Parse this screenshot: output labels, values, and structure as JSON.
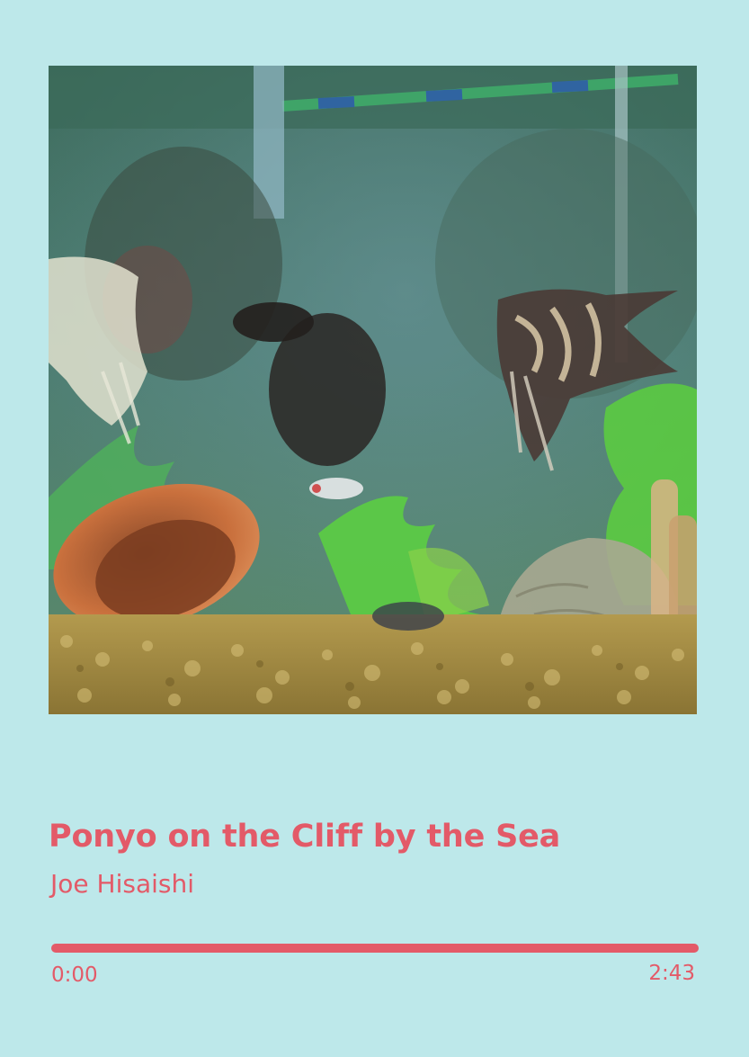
{
  "track": {
    "title": "Ponyo on the Cliff by the Sea",
    "artist": "Joe Hisaishi"
  },
  "playback": {
    "current_time": "0:00",
    "total_time": "2:43",
    "progress_fraction": 1.0
  },
  "colors": {
    "background": "#bde8ea",
    "accent": "#e35a68"
  },
  "artwork": {
    "icon": "album-art-aquarium-photo"
  }
}
